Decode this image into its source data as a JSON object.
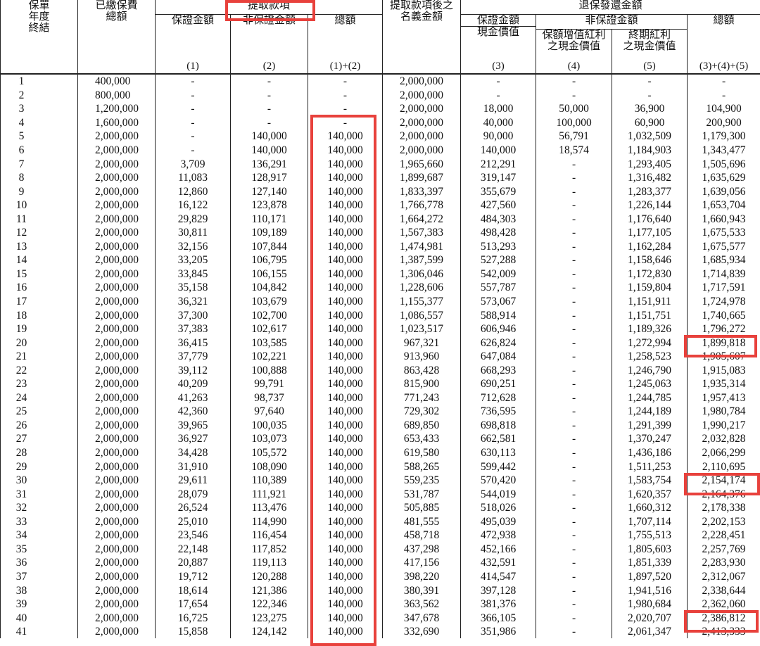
{
  "header": {
    "col_year": [
      "保單",
      "年度",
      "終結"
    ],
    "col_premium": [
      "已繳保費",
      "總額"
    ],
    "withdrawal_group": "提取款項",
    "guaranteed_amount": "保證金額",
    "non_guaranteed_amount": "非保證金額",
    "total": "總額",
    "after_withdrawal": [
      "提取款項後之",
      "名義金額"
    ],
    "surrender_group": "退保發還金額",
    "guaranteed_cash_value": [
      "保證金額",
      "現金價值"
    ],
    "non_guaranteed_group": "非保證金額",
    "rev_bonus": [
      "保額增值紅利",
      "之現金價值"
    ],
    "terminal_bonus": [
      "終期紅利",
      "之現金價值"
    ],
    "surrender_total": "總額",
    "labels": [
      "(1)",
      "(2)",
      "(1)+(2)",
      "(3)",
      "(4)",
      "(5)",
      "(3)+(4)+(5)"
    ]
  },
  "rows": [
    [
      "1",
      "400,000",
      "-",
      "-",
      "-",
      "2,000,000",
      "-",
      "-",
      "-",
      "-"
    ],
    [
      "2",
      "800,000",
      "-",
      "-",
      "-",
      "2,000,000",
      "-",
      "-",
      "-",
      "-"
    ],
    [
      "3",
      "1,200,000",
      "-",
      "-",
      "-",
      "2,000,000",
      "18,000",
      "50,000",
      "36,900",
      "104,900"
    ],
    [
      "4",
      "1,600,000",
      "-",
      "-",
      "-",
      "2,000,000",
      "40,000",
      "100,000",
      "60,900",
      "200,900"
    ],
    [
      "5",
      "2,000,000",
      "-",
      "140,000",
      "140,000",
      "2,000,000",
      "90,000",
      "56,791",
      "1,032,509",
      "1,179,300"
    ],
    [
      "6",
      "2,000,000",
      "-",
      "140,000",
      "140,000",
      "2,000,000",
      "140,000",
      "18,574",
      "1,184,903",
      "1,343,477"
    ],
    [
      "7",
      "2,000,000",
      "3,709",
      "136,291",
      "140,000",
      "1,965,660",
      "212,291",
      "-",
      "1,293,405",
      "1,505,696"
    ],
    [
      "8",
      "2,000,000",
      "11,083",
      "128,917",
      "140,000",
      "1,899,687",
      "319,147",
      "-",
      "1,316,482",
      "1,635,629"
    ],
    [
      "9",
      "2,000,000",
      "12,860",
      "127,140",
      "140,000",
      "1,833,397",
      "355,679",
      "-",
      "1,283,377",
      "1,639,056"
    ],
    [
      "10",
      "2,000,000",
      "16,122",
      "123,878",
      "140,000",
      "1,766,778",
      "427,560",
      "-",
      "1,226,144",
      "1,653,704"
    ],
    [
      "11",
      "2,000,000",
      "29,829",
      "110,171",
      "140,000",
      "1,664,272",
      "484,303",
      "-",
      "1,176,640",
      "1,660,943"
    ],
    [
      "12",
      "2,000,000",
      "30,811",
      "109,189",
      "140,000",
      "1,567,383",
      "498,428",
      "-",
      "1,177,105",
      "1,675,533"
    ],
    [
      "13",
      "2,000,000",
      "32,156",
      "107,844",
      "140,000",
      "1,474,981",
      "513,293",
      "-",
      "1,162,284",
      "1,675,577"
    ],
    [
      "14",
      "2,000,000",
      "33,205",
      "106,795",
      "140,000",
      "1,387,599",
      "527,288",
      "-",
      "1,158,646",
      "1,685,934"
    ],
    [
      "15",
      "2,000,000",
      "33,845",
      "106,155",
      "140,000",
      "1,306,046",
      "542,009",
      "-",
      "1,172,830",
      "1,714,839"
    ],
    [
      "16",
      "2,000,000",
      "35,158",
      "104,842",
      "140,000",
      "1,228,606",
      "557,787",
      "-",
      "1,159,804",
      "1,717,591"
    ],
    [
      "17",
      "2,000,000",
      "36,321",
      "103,679",
      "140,000",
      "1,155,377",
      "573,067",
      "-",
      "1,151,911",
      "1,724,978"
    ],
    [
      "18",
      "2,000,000",
      "37,300",
      "102,700",
      "140,000",
      "1,086,557",
      "588,914",
      "-",
      "1,151,751",
      "1,740,665"
    ],
    [
      "19",
      "2,000,000",
      "37,383",
      "102,617",
      "140,000",
      "1,023,517",
      "606,946",
      "-",
      "1,189,326",
      "1,796,272"
    ],
    [
      "20",
      "2,000,000",
      "36,415",
      "103,585",
      "140,000",
      "967,321",
      "626,824",
      "-",
      "1,272,994",
      "1,899,818"
    ],
    [
      "21",
      "2,000,000",
      "37,779",
      "102,221",
      "140,000",
      "913,960",
      "647,084",
      "-",
      "1,258,523",
      "1,905,607"
    ],
    [
      "22",
      "2,000,000",
      "39,112",
      "100,888",
      "140,000",
      "863,428",
      "668,293",
      "-",
      "1,246,790",
      "1,915,083"
    ],
    [
      "23",
      "2,000,000",
      "40,209",
      "99,791",
      "140,000",
      "815,900",
      "690,251",
      "-",
      "1,245,063",
      "1,935,314"
    ],
    [
      "24",
      "2,000,000",
      "41,263",
      "98,737",
      "140,000",
      "771,243",
      "712,628",
      "-",
      "1,244,785",
      "1,957,413"
    ],
    [
      "25",
      "2,000,000",
      "42,360",
      "97,640",
      "140,000",
      "729,302",
      "736,595",
      "-",
      "1,244,189",
      "1,980,784"
    ],
    [
      "26",
      "2,000,000",
      "39,965",
      "100,035",
      "140,000",
      "689,850",
      "698,818",
      "-",
      "1,291,399",
      "1,990,217"
    ],
    [
      "27",
      "2,000,000",
      "36,927",
      "103,073",
      "140,000",
      "653,433",
      "662,581",
      "-",
      "1,370,247",
      "2,032,828"
    ],
    [
      "28",
      "2,000,000",
      "34,428",
      "105,572",
      "140,000",
      "619,580",
      "630,113",
      "-",
      "1,436,186",
      "2,066,299"
    ],
    [
      "29",
      "2,000,000",
      "31,910",
      "108,090",
      "140,000",
      "588,265",
      "599,442",
      "-",
      "1,511,253",
      "2,110,695"
    ],
    [
      "30",
      "2,000,000",
      "29,611",
      "110,389",
      "140,000",
      "559,235",
      "570,420",
      "-",
      "1,583,754",
      "2,154,174"
    ],
    [
      "31",
      "2,000,000",
      "28,079",
      "111,921",
      "140,000",
      "531,787",
      "544,019",
      "-",
      "1,620,357",
      "2,164,376"
    ],
    [
      "32",
      "2,000,000",
      "26,524",
      "113,476",
      "140,000",
      "505,885",
      "518,026",
      "-",
      "1,660,312",
      "2,178,338"
    ],
    [
      "33",
      "2,000,000",
      "25,010",
      "114,990",
      "140,000",
      "481,555",
      "495,039",
      "-",
      "1,707,114",
      "2,202,153"
    ],
    [
      "34",
      "2,000,000",
      "23,546",
      "116,454",
      "140,000",
      "458,718",
      "472,938",
      "-",
      "1,755,513",
      "2,228,451"
    ],
    [
      "35",
      "2,000,000",
      "22,148",
      "117,852",
      "140,000",
      "437,298",
      "452,166",
      "-",
      "1,805,603",
      "2,257,769"
    ],
    [
      "36",
      "2,000,000",
      "20,887",
      "119,113",
      "140,000",
      "417,156",
      "432,591",
      "-",
      "1,851,339",
      "2,283,930"
    ],
    [
      "37",
      "2,000,000",
      "19,712",
      "120,288",
      "140,000",
      "398,220",
      "414,547",
      "-",
      "1,897,520",
      "2,312,067"
    ],
    [
      "38",
      "2,000,000",
      "18,614",
      "121,386",
      "140,000",
      "380,391",
      "397,128",
      "-",
      "1,941,516",
      "2,338,644"
    ],
    [
      "39",
      "2,000,000",
      "17,654",
      "122,346",
      "140,000",
      "363,562",
      "381,376",
      "-",
      "1,980,684",
      "2,362,060"
    ],
    [
      "40",
      "2,000,000",
      "16,725",
      "123,275",
      "140,000",
      "347,678",
      "366,105",
      "-",
      "2,020,707",
      "2,386,812"
    ],
    [
      "41",
      "2,000,000",
      "15,858",
      "124,142",
      "140,000",
      "332,690",
      "351,986",
      "-",
      "2,061,347",
      "2,413,333"
    ]
  ],
  "highlight_color": "#e8413c"
}
